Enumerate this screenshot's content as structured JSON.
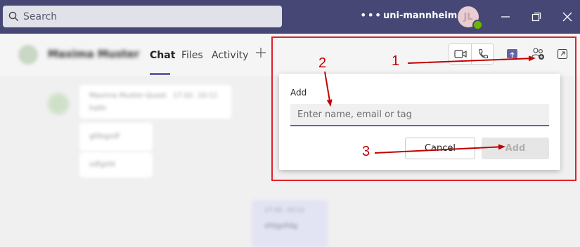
{
  "titlebar": {
    "search_placeholder": "Search",
    "more_icon": "more-dots",
    "org_name": "uni-mannheim.de",
    "avatar_initials": "JL",
    "presence_color": "#6bb700",
    "accent_color": "#464775"
  },
  "chat_header": {
    "contact_name": "Maxima Muster",
    "tabs": [
      {
        "label": "Chat",
        "active": true
      },
      {
        "label": "Files",
        "active": false
      },
      {
        "label": "Activity",
        "active": false
      }
    ],
    "add_tab_icon": "plus-icon",
    "toolbar_icons": [
      "video-call-icon",
      "audio-call-icon",
      "share-screen-icon",
      "add-people-icon",
      "pop-out-icon"
    ]
  },
  "messages": [
    {
      "sender": "Maxima Muster-Quast",
      "time": "17.02. 10:11",
      "text": "hallo"
    },
    {
      "text": "gfdsgsdf"
    },
    {
      "text": "sdfgsfd"
    }
  ],
  "sent_message": {
    "time": "17.02. 10:11",
    "text": "sfdgsfdg"
  },
  "add_popup": {
    "label": "Add",
    "input_placeholder": "Enter name, email or tag",
    "cancel_label": "Cancel",
    "add_label": "Add"
  },
  "annotations": {
    "numbers": [
      "1",
      "2",
      "3"
    ],
    "highlight_color": "#e0212c",
    "arrow_color": "#c00000"
  }
}
